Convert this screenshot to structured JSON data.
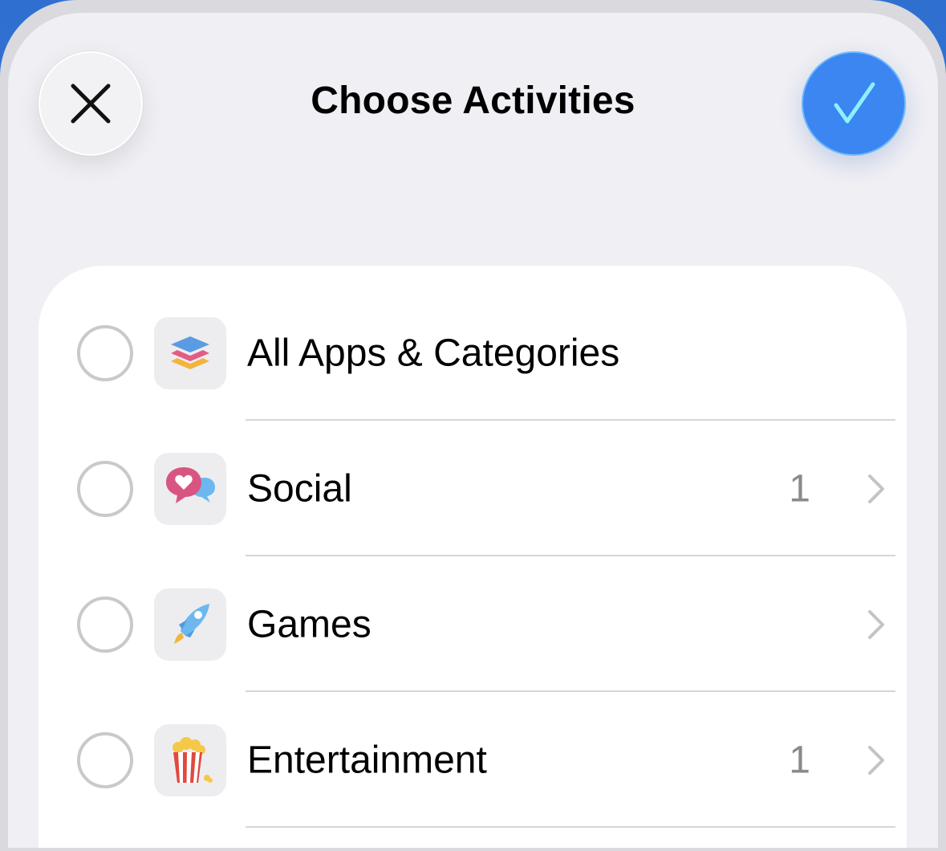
{
  "header": {
    "title": "Choose Activities",
    "close_icon": "close-icon",
    "confirm_icon": "checkmark-icon",
    "accent_color": "#3b86f0"
  },
  "list": {
    "items": [
      {
        "label": "All Apps & Categories",
        "count": "",
        "icon": "stack-icon",
        "has_chevron": false,
        "selected": false
      },
      {
        "label": "Social",
        "count": "1",
        "icon": "chat-bubbles-heart-icon",
        "has_chevron": true,
        "selected": false
      },
      {
        "label": "Games",
        "count": "",
        "icon": "rocket-icon",
        "has_chevron": true,
        "selected": false
      },
      {
        "label": "Entertainment",
        "count": "1",
        "icon": "popcorn-icon",
        "has_chevron": true,
        "selected": false
      }
    ]
  }
}
